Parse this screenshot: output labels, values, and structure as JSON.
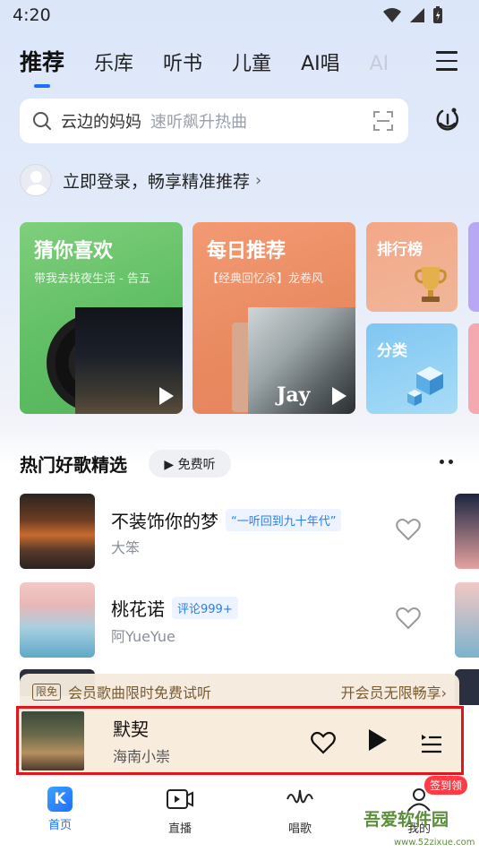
{
  "status_bar": {
    "time": "4:20"
  },
  "tabs": [
    {
      "label": "推荐"
    },
    {
      "label": "乐库"
    },
    {
      "label": "听书"
    },
    {
      "label": "儿童"
    },
    {
      "label": "AI唱"
    },
    {
      "label": "AI"
    }
  ],
  "search": {
    "query": "云边的妈妈",
    "hint": "速听飙升热曲"
  },
  "login": {
    "text": "立即登录，畅享精准推荐",
    "chevron": "›"
  },
  "cards": {
    "guess": {
      "title": "猜你喜欢",
      "subtitle": "带我去找夜生活 - 告五"
    },
    "daily": {
      "title": "每日推荐",
      "subtitle": "【经典回忆杀】龙卷风",
      "album_text": "Jay"
    },
    "rank": {
      "title": "排行榜"
    },
    "category": {
      "title": "分类"
    }
  },
  "section": {
    "title": "热门好歌精选",
    "free_label": "▶ 免费听"
  },
  "songs": [
    {
      "name": "不装饰你的梦",
      "tag": "“一听回到九十年代”",
      "artist": "大笨"
    },
    {
      "name": "桃花诺",
      "tag": "评论999+",
      "artist": "阿YueYue"
    }
  ],
  "vip": {
    "badge": "限免",
    "text": "会员歌曲限时免费试听",
    "cta": "开会员无限畅享›"
  },
  "player": {
    "title": "默契",
    "artist": "海南小崇"
  },
  "nav": [
    {
      "label": "首页",
      "icon": "K"
    },
    {
      "label": "直播"
    },
    {
      "label": "唱歌"
    },
    {
      "label": "我的"
    }
  ],
  "nav_badge": "签到领",
  "watermark": {
    "text": "吾爱软件园",
    "url": "www.52zixue.com"
  },
  "colors": {
    "accent": "#1f6fff",
    "highlight_border": "#e0161e",
    "vip_text": "#7a5a2f"
  }
}
